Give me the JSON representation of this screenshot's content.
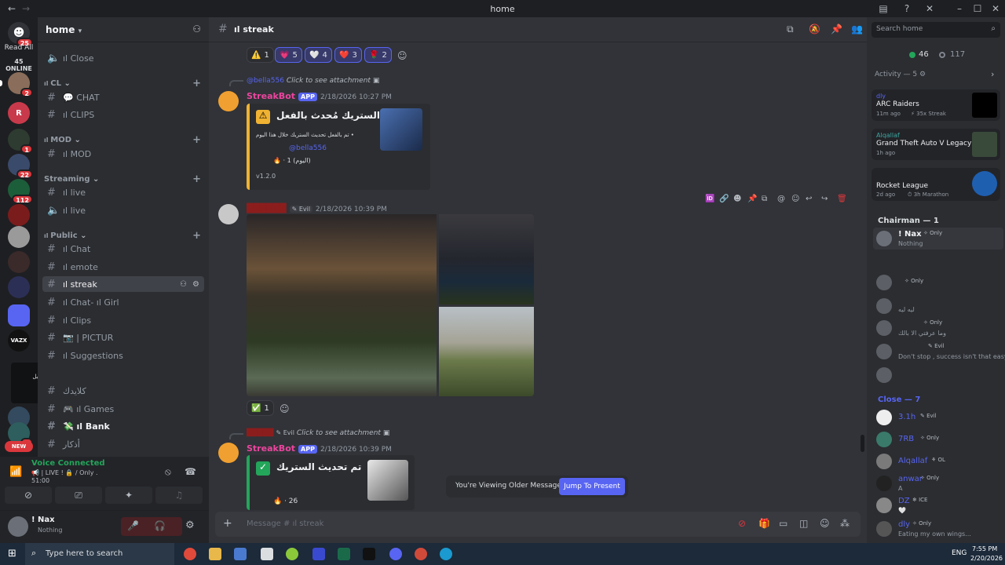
{
  "window": {
    "title": "home"
  },
  "rail": {
    "read_all": "Read All",
    "online": "45 ONLINE",
    "new_label": "NEW",
    "servers": [
      {
        "badge": "2"
      },
      {
        "initial": "R"
      },
      {
        "badge": "1"
      },
      {
        "badge": "22"
      },
      {
        "badge": "112"
      },
      {},
      {},
      {},
      {},
      {},
      {
        "initial": "VAZX"
      },
      {},
      {},
      {
        "badge": "1"
      }
    ],
    "tooltip_line1": "مطر عليش بالبرارو : IMGny",
    "tooltip_line2": "يحنون بيدا الحرش بل : ilNawaf",
    "tooltip_line3": "الخرطي",
    "first_badge": "25"
  },
  "guild": {
    "name": "home",
    "channels": [
      {
        "label": "ıl Close",
        "type": "voice"
      },
      {
        "label": "CL",
        "type": "category"
      },
      {
        "label": "💬 CHAT",
        "type": "text"
      },
      {
        "label": "ıl CLIPS",
        "type": "text"
      },
      {
        "label": "MOD",
        "type": "category"
      },
      {
        "label": "ıl MOD",
        "type": "text"
      },
      {
        "label": "Streaming",
        "type": "category"
      },
      {
        "label": "ıl live",
        "type": "text"
      },
      {
        "label": "ıl live",
        "type": "voice"
      },
      {
        "label": "Public",
        "type": "category"
      },
      {
        "label": "ıl Chat",
        "type": "text"
      },
      {
        "label": "ıl emote",
        "type": "text"
      },
      {
        "label": "ıl streak",
        "type": "text",
        "active": true
      },
      {
        "label": "ıl Chat- ıl Girl",
        "type": "text"
      },
      {
        "label": "ıl Clips",
        "type": "text"
      },
      {
        "label": "📷 | PICTUR",
        "type": "text"
      },
      {
        "label": "ıl Suggestions",
        "type": "text"
      },
      {
        "label": "كلايدك",
        "type": "text"
      },
      {
        "label": "🎮 ıl Games",
        "type": "text"
      },
      {
        "label": "💸 ıl Bank",
        "type": "text",
        "bold": true
      },
      {
        "label": "أذكار",
        "type": "text"
      }
    ],
    "close_partial": "ıl Close"
  },
  "voice": {
    "status": "Voice Connected",
    "channel": "📢 | LIVE ! 🔒 / Only .",
    "timer": "51:00"
  },
  "user": {
    "name": "! Nax",
    "status": "Nothing"
  },
  "chat": {
    "channel_name": "ıl streak",
    "reactions_top": [
      {
        "emoji": "⚠️",
        "count": "1"
      },
      {
        "emoji": "💗",
        "count": "5"
      },
      {
        "emoji": "🤍",
        "count": "4"
      },
      {
        "emoji": "❤️",
        "count": "3"
      },
      {
        "emoji": "🌹",
        "count": "2"
      }
    ],
    "messages": [
      {
        "reply_user": "@bella556",
        "reply_text": "Click to see attachment",
        "author": "StreakBot",
        "app_tag": "APP",
        "timestamp": "2/18/2026 10:27 PM",
        "embed_title": "الستريك مُحدث بالفعل •",
        "embed_line1": "تم بالفعل تحديث الستريك خلال هذا اليوم •",
        "embed_mention": "@bella556",
        "embed_count": "1 (اليوم)",
        "embed_version": "v1.2.0"
      },
      {
        "author_tag": "Evil",
        "timestamp": "2/18/2026 10:39 PM",
        "reaction": {
          "emoji": "✅",
          "count": "1"
        }
      },
      {
        "reply_tag": "Evil",
        "reply_text": "Click to see attachment",
        "author": "StreakBot",
        "app_tag": "APP",
        "timestamp": "2/18/2026 10:39 PM",
        "embed_title": "تم تحديث الستريك",
        "embed_count": "26"
      }
    ],
    "older_notice": "You're Viewing Older Messages",
    "jump_button": "Jump To Present",
    "input_placeholder": "Message # ıl streak"
  },
  "members": {
    "search_placeholder": "Search home",
    "online_count": "46",
    "offline_count": "117",
    "activity_header": "Activity — 5",
    "activities": [
      {
        "user": "dly",
        "game": "ARC Raiders",
        "meta": "11m ago",
        "extra": "35x Streak"
      },
      {
        "user": "Alqallaf",
        "game": "Grand Theft Auto V Legacy",
        "meta": "1h ago"
      },
      {
        "user": "",
        "game": "Rocket League",
        "meta": "2d ago",
        "extra": "3h Marathon"
      }
    ],
    "chairman_header": "Chairman — 1",
    "chairman": [
      {
        "name": "! Nax",
        "tag": "Only",
        "status": "Nothing"
      }
    ],
    "group2": [
      {
        "name": "",
        "tag": "Only"
      },
      {
        "name": "",
        "status": "ليه ليه"
      },
      {
        "name": "",
        "tag": "Only",
        "status": "وما عرفتي الا بالك"
      },
      {
        "name": "",
        "tag": "Evil",
        "status": "Don't stop , success isn't that easy"
      },
      {
        "name": ""
      }
    ],
    "close_header": "Close — 7",
    "close": [
      {
        "name": "3.1h",
        "tag": "Evil"
      },
      {
        "name": "7RB",
        "tag": "Only"
      },
      {
        "name": "Alqallaf",
        "tag": "OL"
      },
      {
        "name": "anwar",
        "tag": "Only",
        "status": "A"
      },
      {
        "name": "DZ",
        "tag": "ICE",
        "status": "🤍"
      },
      {
        "name": "dly",
        "tag": "Only",
        "status": "Eating my own wings..."
      }
    ]
  },
  "taskbar": {
    "search": "Type here to search",
    "lang": "ENG",
    "time": "7:55 PM",
    "date": "2/20/2026"
  },
  "colors": {
    "accent": "#5865f2",
    "bot_name": "#eb459e",
    "warn_bar": "#f0b232",
    "ok_bar": "#23a55a",
    "online": "#23a55a",
    "danger": "#da373c"
  }
}
